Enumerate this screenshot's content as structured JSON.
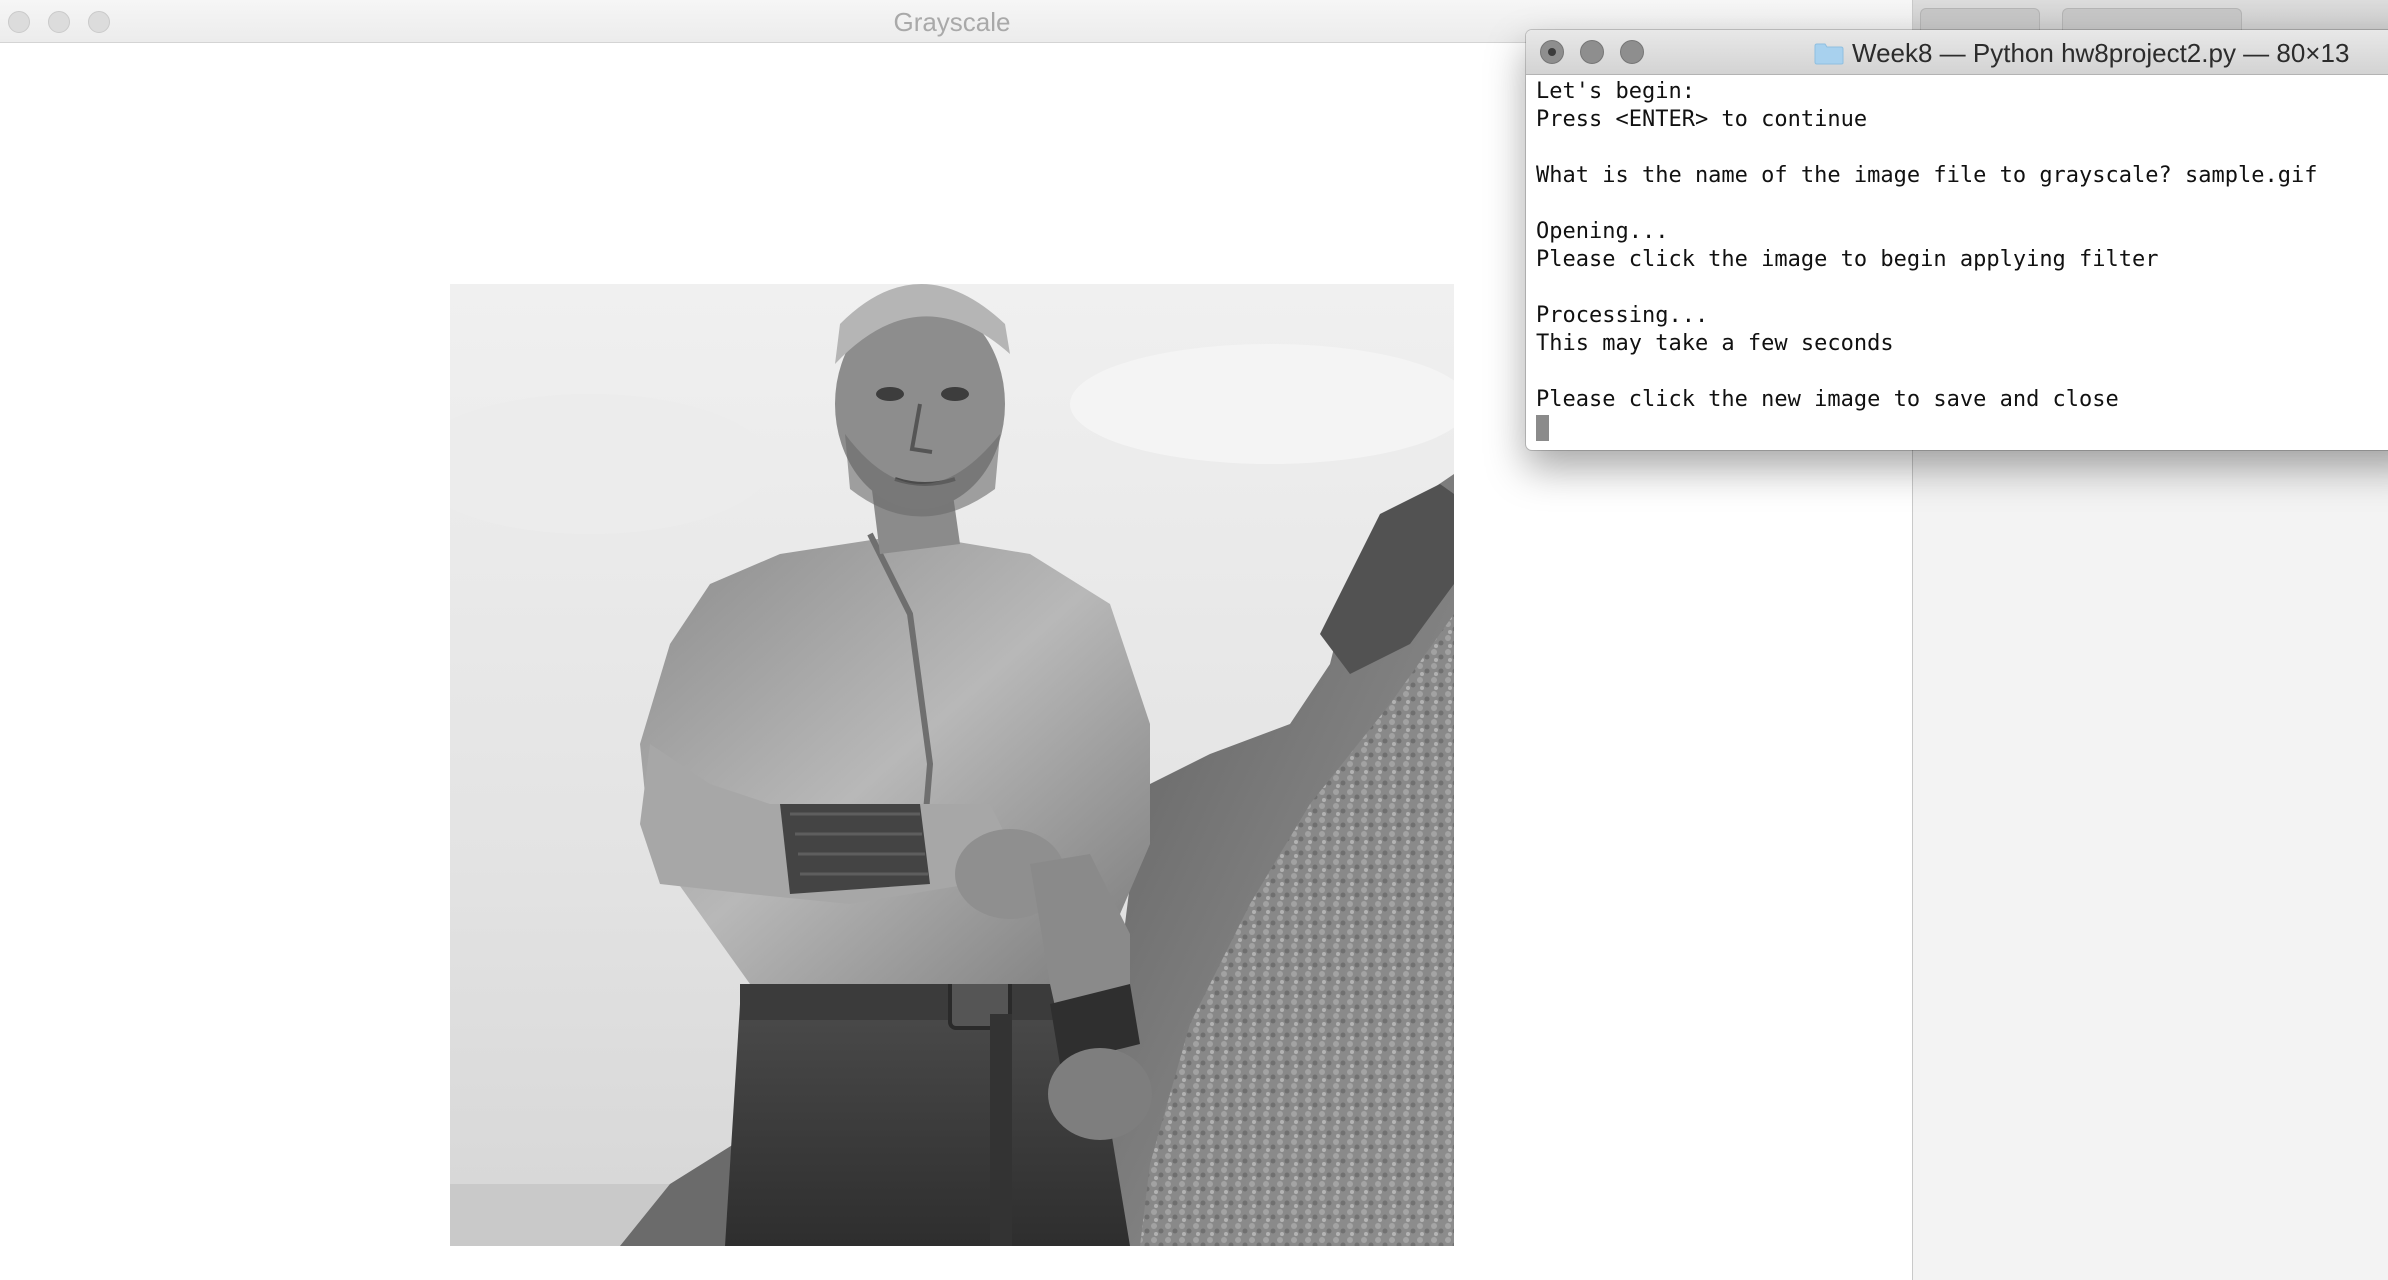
{
  "grayscale_window": {
    "title": "Grayscale",
    "image": {
      "description_icon": "grayscale-photo-icon"
    }
  },
  "terminal": {
    "title": "Week8 — Python hw8project2.py — 80×13",
    "folder_icon": "folder-icon",
    "folder_color": "#a8d1ee",
    "lines": [
      "Let's begin:",
      "Press <ENTER> to continue",
      "",
      "What is the name of the image file to grayscale? sample.gif",
      "",
      "Opening...",
      "Please click the image to begin applying filter",
      "",
      "Processing...",
      "This may take a few seconds",
      "",
      "Please click the new image to save and close"
    ]
  }
}
